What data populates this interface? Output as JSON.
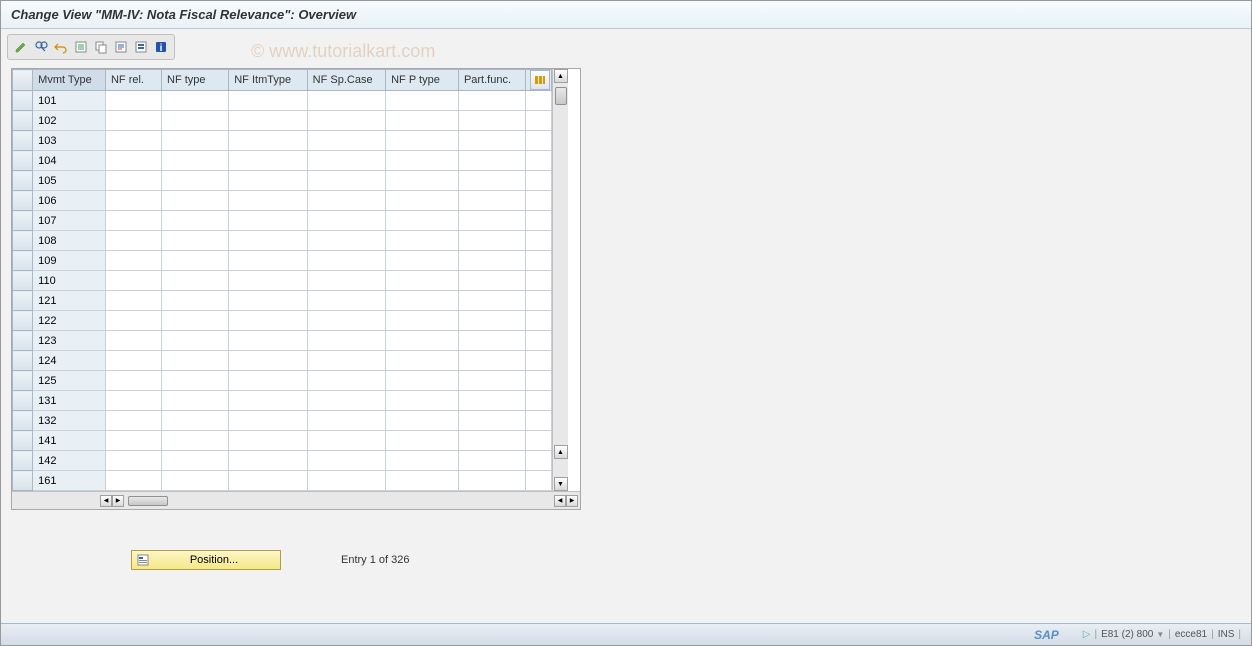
{
  "title": "Change View \"MM-IV: Nota Fiscal Relevance\": Overview",
  "watermark": "© www.tutorialkart.com",
  "toolbar": {
    "icons": [
      "edit",
      "glasses",
      "undo",
      "new-entries",
      "copy",
      "delete",
      "select-all",
      "info"
    ]
  },
  "table": {
    "columns": [
      "Mvmt Type",
      "NF rel.",
      "NF type",
      "NF ItmType",
      "NF Sp.Case",
      "NF P type",
      "Part.func."
    ],
    "rows": [
      {
        "mvmt": "101"
      },
      {
        "mvmt": "102"
      },
      {
        "mvmt": "103"
      },
      {
        "mvmt": "104"
      },
      {
        "mvmt": "105"
      },
      {
        "mvmt": "106"
      },
      {
        "mvmt": "107"
      },
      {
        "mvmt": "108"
      },
      {
        "mvmt": "109"
      },
      {
        "mvmt": "110"
      },
      {
        "mvmt": "121"
      },
      {
        "mvmt": "122"
      },
      {
        "mvmt": "123"
      },
      {
        "mvmt": "124"
      },
      {
        "mvmt": "125"
      },
      {
        "mvmt": "131"
      },
      {
        "mvmt": "132"
      },
      {
        "mvmt": "141"
      },
      {
        "mvmt": "142"
      },
      {
        "mvmt": "161"
      }
    ]
  },
  "position_button": "Position...",
  "entry_text": "Entry 1 of 326",
  "status": {
    "sap": "SAP",
    "session": "E81 (2) 800",
    "server": "ecce81",
    "mode": "INS"
  }
}
